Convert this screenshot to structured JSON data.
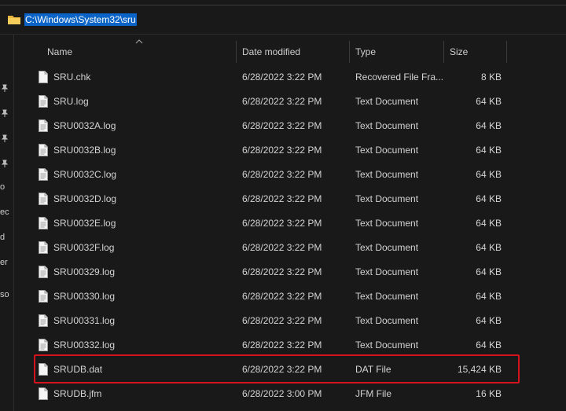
{
  "address_bar": {
    "path": "C:\\Windows\\System32\\sru"
  },
  "left_pane": {
    "fragments": [
      "o",
      "ec",
      "d",
      "er",
      "so"
    ]
  },
  "columns": {
    "name": "Name",
    "date": "Date modified",
    "type": "Type",
    "size": "Size"
  },
  "files": [
    {
      "name": "SRU.chk",
      "date": "6/28/2022 3:22 PM",
      "type": "Recovered File Fra...",
      "size": "8 KB"
    },
    {
      "name": "SRU.log",
      "date": "6/28/2022 3:22 PM",
      "type": "Text Document",
      "size": "64 KB"
    },
    {
      "name": "SRU0032A.log",
      "date": "6/28/2022 3:22 PM",
      "type": "Text Document",
      "size": "64 KB"
    },
    {
      "name": "SRU0032B.log",
      "date": "6/28/2022 3:22 PM",
      "type": "Text Document",
      "size": "64 KB"
    },
    {
      "name": "SRU0032C.log",
      "date": "6/28/2022 3:22 PM",
      "type": "Text Document",
      "size": "64 KB"
    },
    {
      "name": "SRU0032D.log",
      "date": "6/28/2022 3:22 PM",
      "type": "Text Document",
      "size": "64 KB"
    },
    {
      "name": "SRU0032E.log",
      "date": "6/28/2022 3:22 PM",
      "type": "Text Document",
      "size": "64 KB"
    },
    {
      "name": "SRU0032F.log",
      "date": "6/28/2022 3:22 PM",
      "type": "Text Document",
      "size": "64 KB"
    },
    {
      "name": "SRU00329.log",
      "date": "6/28/2022 3:22 PM",
      "type": "Text Document",
      "size": "64 KB"
    },
    {
      "name": "SRU00330.log",
      "date": "6/28/2022 3:22 PM",
      "type": "Text Document",
      "size": "64 KB"
    },
    {
      "name": "SRU00331.log",
      "date": "6/28/2022 3:22 PM",
      "type": "Text Document",
      "size": "64 KB"
    },
    {
      "name": "SRU00332.log",
      "date": "6/28/2022 3:22 PM",
      "type": "Text Document",
      "size": "64 KB"
    },
    {
      "name": "SRUDB.dat",
      "date": "6/28/2022 3:22 PM",
      "type": "DAT File",
      "size": "15,424 KB"
    },
    {
      "name": "SRUDB.jfm",
      "date": "6/28/2022 3:00 PM",
      "type": "JFM File",
      "size": "16 KB"
    }
  ],
  "colors": {
    "highlight": "#d4141c",
    "selection": "#0a64c8",
    "background": "#191919"
  },
  "icons": {
    "folder": "folder-icon",
    "file": "file-icon",
    "pin": "pin-icon",
    "sort": "sort-ascending-icon"
  }
}
